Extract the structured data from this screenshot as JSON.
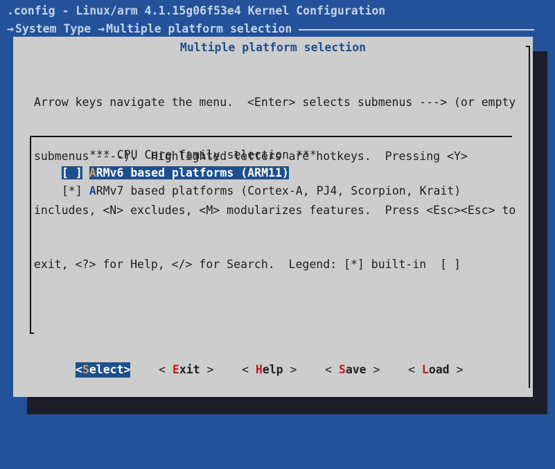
{
  "window": {
    "title": ".config - Linux/arm 4.1.15g06f53e4 Kernel Configuration"
  },
  "breadcrumb": {
    "arrow": "→",
    "items": [
      "System Type",
      "Multiple platform selection"
    ]
  },
  "dialog": {
    "title": "Multiple platform selection",
    "help_lines": [
      "Arrow keys navigate the menu.  <Enter> selects submenus ---> (or empty",
      "submenus ----).  Highlighted letters are hotkeys.  Pressing <Y>",
      "includes, <N> excludes, <M> modularizes features.  Press <Esc><Esc> to",
      "exit, <?> for Help, </> for Search.  Legend: [*] built-in  [ ]"
    ]
  },
  "menu": {
    "heading": "*** CPU Core family selection ***",
    "items": [
      {
        "checkbox": "[ ]",
        "hotkey": "A",
        "label": "RMv6 based platforms (ARM11)",
        "selected": true
      },
      {
        "checkbox": "[*]",
        "hotkey": "A",
        "label": "RMv7 based platforms (Cortex-A, PJ4, Scorpion, Krait)",
        "selected": false
      }
    ]
  },
  "buttons": [
    {
      "open": "<",
      "hotkey": "S",
      "rest": "elect",
      "close": ">",
      "selected": true
    },
    {
      "open": "< ",
      "hotkey": "E",
      "rest": "xit",
      "close": " >",
      "selected": false
    },
    {
      "open": "< ",
      "hotkey": "H",
      "rest": "elp",
      "close": " >",
      "selected": false
    },
    {
      "open": "< ",
      "hotkey": "S",
      "rest": "ave",
      "close": " >",
      "selected": false
    },
    {
      "open": "< ",
      "hotkey": "L",
      "rest": "oad",
      "close": " >",
      "selected": false
    }
  ],
  "colors": {
    "background": "#23529a",
    "dialog": "#cdcdcd",
    "highlight": "#1d4f8e",
    "hotkey_red": "#b81d1d",
    "hotkey_orange": "#d9a05b",
    "title_blue": "#1f4d8c"
  }
}
